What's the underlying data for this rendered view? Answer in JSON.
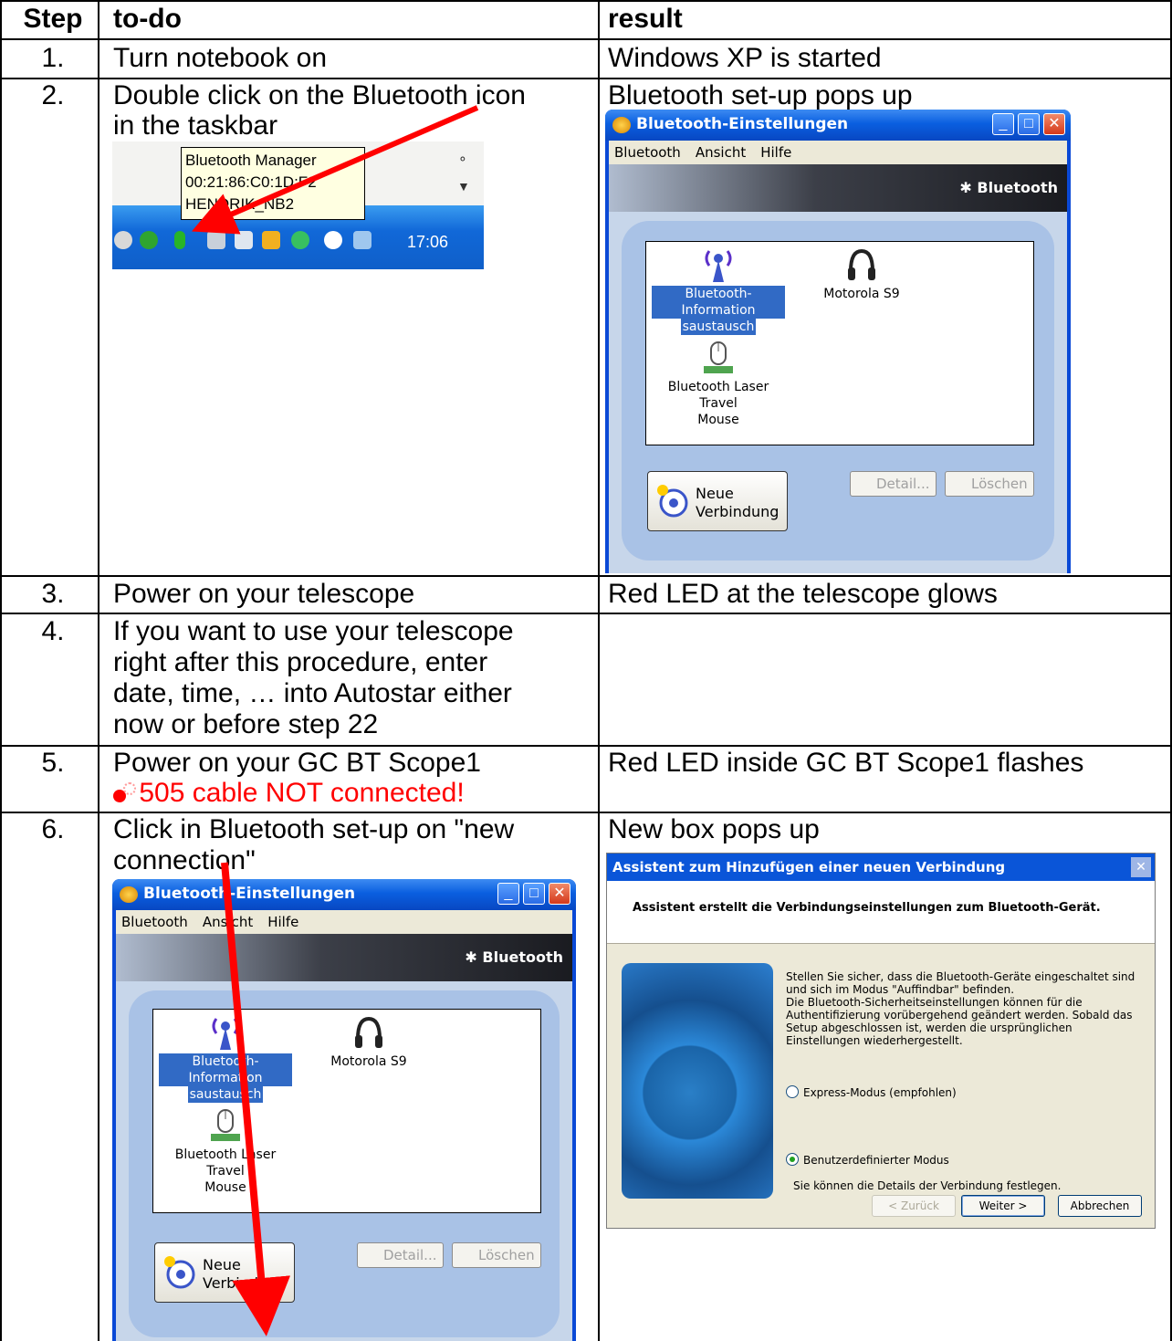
{
  "table": {
    "headers": {
      "step": "Step",
      "todo": "to-do",
      "result": "result"
    },
    "rows": [
      {
        "step": "1.",
        "todo": [
          "Turn notebook on"
        ],
        "result": "Windows XP is started"
      },
      {
        "step": "2.",
        "todo": [
          "Double click on the Bluetooth icon",
          "in the taskbar"
        ],
        "result": "Bluetooth set-up pops up"
      },
      {
        "step": "3.",
        "todo": [
          "Power on your telescope"
        ],
        "result": "Red LED at the telescope glows"
      },
      {
        "step": "4.",
        "todo": [
          "If you want to use your telescope",
          "right after this procedure, enter",
          "date, time, … into Autostar either",
          "now or before step 22"
        ],
        "result": ""
      },
      {
        "step": "5.",
        "todo": [
          "Power on your GC BT Scope1"
        ],
        "warning": "505 cable NOT connected!",
        "result": "Red LED inside GC BT Scope1 flashes"
      },
      {
        "step": "6.",
        "todo": [
          "Click in Bluetooth set-up on \"new",
          "connection\""
        ],
        "result": "New box pops up"
      }
    ]
  },
  "taskbar_screenshot": {
    "tooltip": [
      "Bluetooth Manager",
      "00:21:86:C0:1D:F2",
      "HENDRIK_NB2"
    ],
    "time": "17:06"
  },
  "bt_window": {
    "title": "Bluetooth-Einstellungen",
    "menu": [
      "Bluetooth",
      "Ansicht",
      "Hilfe"
    ],
    "brand": "Bluetooth",
    "devices": {
      "info": [
        "Bluetooth-Information",
        "saustausch"
      ],
      "phone": "Motorola S9",
      "mouse": [
        "Bluetooth Laser Travel",
        "Mouse"
      ]
    },
    "new_connection": [
      "Neue",
      "Verbindung"
    ],
    "detail": "Detail...",
    "delete": "Löschen"
  },
  "wizard": {
    "title": "Assistent zum Hinzufügen einer neuen Verbindung",
    "heading": "Assistent erstellt die Verbindungseinstellungen zum Bluetooth-Gerät.",
    "description": [
      "Stellen Sie sicher, dass die Bluetooth-Geräte eingeschaltet sind",
      "und sich im Modus \"Auffindbar\" befinden.",
      "Die Bluetooth-Sicherheitseinstellungen können für die",
      "Authentifizierung vorübergehend geändert werden. Sobald das",
      "Setup abgeschlossen ist, werden die ursprünglichen",
      "Einstellungen wiederhergestellt."
    ],
    "option_express": "Express-Modus (empfohlen)",
    "option_custom": "Benutzerdefinierter Modus",
    "option_custom_sub": "Sie können die Details der Verbindung festlegen.",
    "back": "< Zurück",
    "next": "Weiter >",
    "cancel": "Abbrechen"
  },
  "colors": {
    "warning": "#ff0000",
    "arrow": "#ff0000",
    "xp_blue": "#0a55d8"
  }
}
